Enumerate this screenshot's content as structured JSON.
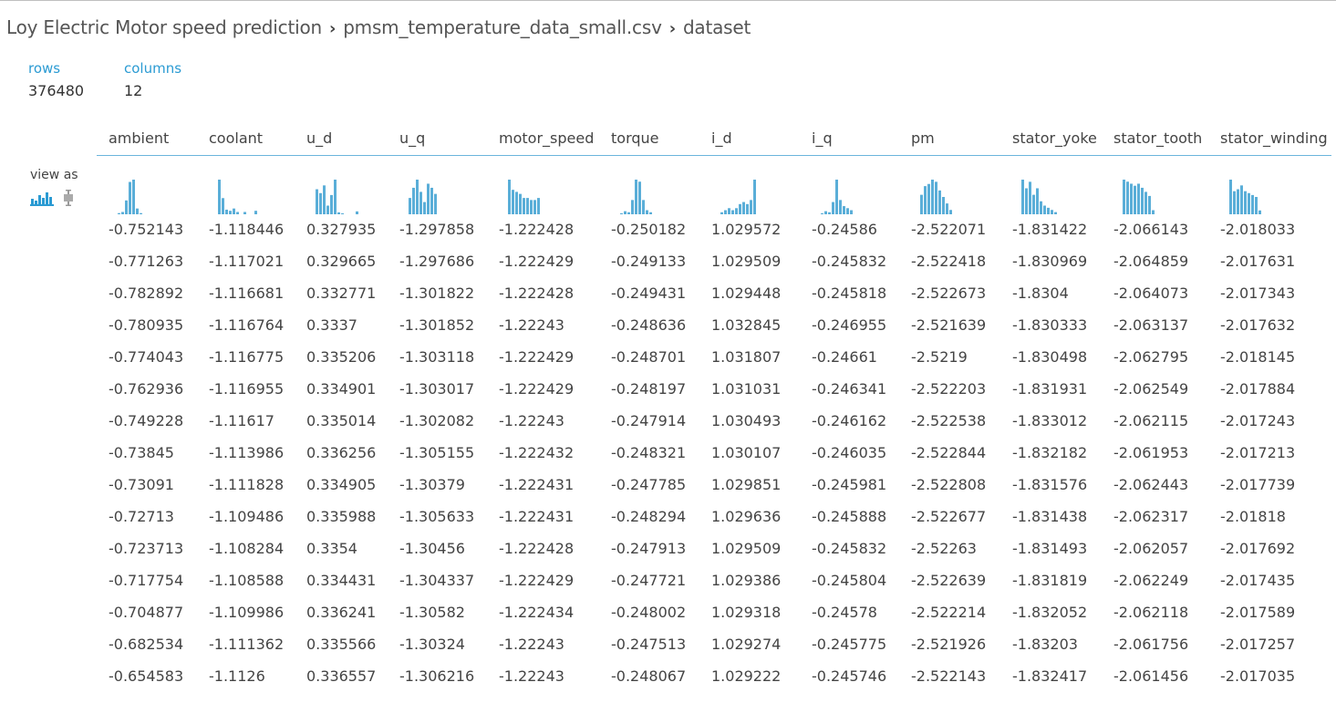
{
  "breadcrumb": [
    "Loy Electric Motor speed prediction",
    "pmsm_temperature_data_small.csv",
    "dataset"
  ],
  "separator": "›",
  "stats": {
    "rows_label": "rows",
    "rows_value": "376480",
    "columns_label": "columns",
    "columns_value": "12"
  },
  "view_as": {
    "label": "view as",
    "icons": [
      "histogram-icon",
      "boxplot-icon"
    ]
  },
  "accent_color": "#2b9bd3",
  "bar_color": "#5aaed8",
  "columns": [
    "ambient",
    "coolant",
    "u_d",
    "u_q",
    "motor_speed",
    "torque",
    "i_d",
    "i_q",
    "pm",
    "stator_yoke",
    "stator_tooth",
    "stator_winding"
  ],
  "histograms": [
    [
      1,
      2,
      12,
      28,
      30,
      5,
      1
    ],
    [
      30,
      14,
      4,
      3,
      5,
      2,
      0,
      2,
      0,
      0,
      3
    ],
    [
      26,
      22,
      30,
      9,
      20,
      36,
      2,
      1,
      0,
      0,
      0,
      3
    ],
    [
      16,
      26,
      34,
      22,
      12,
      30,
      26,
      20
    ],
    [
      34,
      24,
      22,
      20,
      16,
      16,
      14,
      14,
      16
    ],
    [
      1,
      3,
      2,
      14,
      34,
      32,
      14,
      4,
      2
    ],
    [
      2,
      4,
      6,
      4,
      6,
      10,
      12,
      10,
      14,
      34
    ],
    [
      1,
      3,
      2,
      12,
      34,
      14,
      8,
      6,
      4
    ],
    [
      18,
      26,
      28,
      32,
      30,
      22,
      16,
      10,
      4
    ],
    [
      32,
      24,
      30,
      18,
      24,
      12,
      8,
      6,
      4,
      2
    ],
    [
      34,
      32,
      30,
      28,
      30,
      26,
      22,
      18,
      4
    ],
    [
      36,
      24,
      26,
      30,
      24,
      22,
      20,
      18,
      4
    ]
  ],
  "rows": [
    [
      "-0.752143",
      "-1.118446",
      "0.327935",
      "-1.297858",
      "-1.222428",
      "-0.250182",
      "1.029572",
      "-0.24586",
      "-2.522071",
      "-1.831422",
      "-2.066143",
      "-2.018033"
    ],
    [
      "-0.771263",
      "-1.117021",
      "0.329665",
      "-1.297686",
      "-1.222429",
      "-0.249133",
      "1.029509",
      "-0.245832",
      "-2.522418",
      "-1.830969",
      "-2.064859",
      "-2.017631"
    ],
    [
      "-0.782892",
      "-1.116681",
      "0.332771",
      "-1.301822",
      "-1.222428",
      "-0.249431",
      "1.029448",
      "-0.245818",
      "-2.522673",
      "-1.8304",
      "-2.064073",
      "-2.017343"
    ],
    [
      "-0.780935",
      "-1.116764",
      "0.3337",
      "-1.301852",
      "-1.22243",
      "-0.248636",
      "1.032845",
      "-0.246955",
      "-2.521639",
      "-1.830333",
      "-2.063137",
      "-2.017632"
    ],
    [
      "-0.774043",
      "-1.116775",
      "0.335206",
      "-1.303118",
      "-1.222429",
      "-0.248701",
      "1.031807",
      "-0.24661",
      "-2.5219",
      "-1.830498",
      "-2.062795",
      "-2.018145"
    ],
    [
      "-0.762936",
      "-1.116955",
      "0.334901",
      "-1.303017",
      "-1.222429",
      "-0.248197",
      "1.031031",
      "-0.246341",
      "-2.522203",
      "-1.831931",
      "-2.062549",
      "-2.017884"
    ],
    [
      "-0.749228",
      "-1.11617",
      "0.335014",
      "-1.302082",
      "-1.22243",
      "-0.247914",
      "1.030493",
      "-0.246162",
      "-2.522538",
      "-1.833012",
      "-2.062115",
      "-2.017243"
    ],
    [
      "-0.73845",
      "-1.113986",
      "0.336256",
      "-1.305155",
      "-1.222432",
      "-0.248321",
      "1.030107",
      "-0.246035",
      "-2.522844",
      "-1.832182",
      "-2.061953",
      "-2.017213"
    ],
    [
      "-0.73091",
      "-1.111828",
      "0.334905",
      "-1.30379",
      "-1.222431",
      "-0.247785",
      "1.029851",
      "-0.245981",
      "-2.522808",
      "-1.831576",
      "-2.062443",
      "-2.017739"
    ],
    [
      "-0.72713",
      "-1.109486",
      "0.335988",
      "-1.305633",
      "-1.222431",
      "-0.248294",
      "1.029636",
      "-0.245888",
      "-2.522677",
      "-1.831438",
      "-2.062317",
      "-2.01818"
    ],
    [
      "-0.723713",
      "-1.108284",
      "0.3354",
      "-1.30456",
      "-1.222428",
      "-0.247913",
      "1.029509",
      "-0.245832",
      "-2.52263",
      "-1.831493",
      "-2.062057",
      "-2.017692"
    ],
    [
      "-0.717754",
      "-1.108588",
      "0.334431",
      "-1.304337",
      "-1.222429",
      "-0.247721",
      "1.029386",
      "-0.245804",
      "-2.522639",
      "-1.831819",
      "-2.062249",
      "-2.017435"
    ],
    [
      "-0.704877",
      "-1.109986",
      "0.336241",
      "-1.30582",
      "-1.222434",
      "-0.248002",
      "1.029318",
      "-0.24578",
      "-2.522214",
      "-1.832052",
      "-2.062118",
      "-2.017589"
    ],
    [
      "-0.682534",
      "-1.111362",
      "0.335566",
      "-1.30324",
      "-1.22243",
      "-0.247513",
      "1.029274",
      "-0.245775",
      "-2.521926",
      "-1.83203",
      "-2.061756",
      "-2.017257"
    ],
    [
      "-0.654583",
      "-1.1126",
      "0.336557",
      "-1.306216",
      "-1.22243",
      "-0.248067",
      "1.029222",
      "-0.245746",
      "-2.522143",
      "-1.832417",
      "-2.061456",
      "-2.017035"
    ]
  ]
}
